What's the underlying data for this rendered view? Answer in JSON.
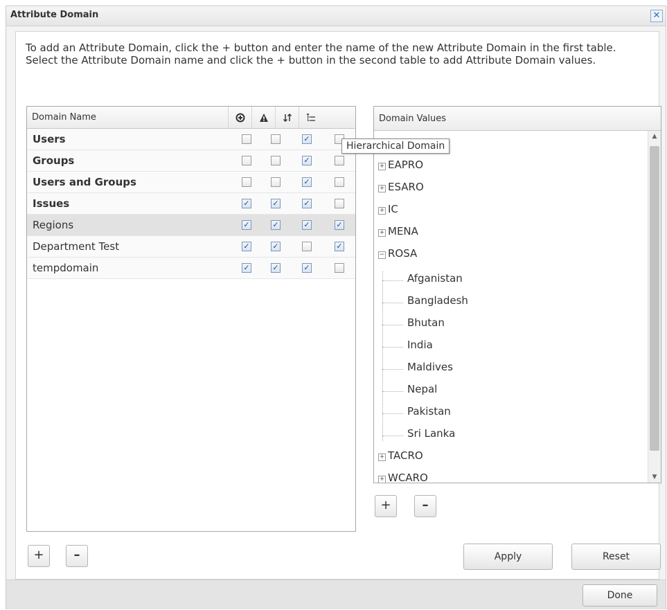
{
  "dialog": {
    "title": "Attribute Domain",
    "close_label": "✕",
    "instructions": "To add an Attribute Domain, click the + button and enter the name of the new Attribute Domain in the first table. Select the Attribute Domain name and click the + button in the second table to add Attribute Domain values."
  },
  "domains_table": {
    "header": "Domain Name",
    "column_icons": [
      "add-circle-icon",
      "warning-icon",
      "sort-icon",
      "hierarchy-icon"
    ],
    "rows": [
      {
        "name": "Users",
        "bold": true,
        "checks": [
          false,
          false,
          true,
          false
        ]
      },
      {
        "name": "Groups",
        "bold": true,
        "checks": [
          false,
          false,
          true,
          false
        ]
      },
      {
        "name": "Users and Groups",
        "bold": true,
        "checks": [
          false,
          false,
          true,
          false
        ]
      },
      {
        "name": "Issues",
        "bold": true,
        "checks": [
          true,
          true,
          true,
          false
        ]
      },
      {
        "name": "Regions",
        "bold": false,
        "selected": true,
        "checks": [
          true,
          true,
          true,
          true
        ]
      },
      {
        "name": "Department Test",
        "bold": false,
        "checks": [
          true,
          true,
          false,
          true
        ]
      },
      {
        "name": "tempdomain",
        "bold": false,
        "checks": [
          true,
          true,
          true,
          false
        ]
      }
    ],
    "add_label": "+",
    "remove_label": "–"
  },
  "tooltip": "Hierarchical Domain",
  "values_panel": {
    "header": "Domain Values",
    "nodes": [
      {
        "label": "EAPRO",
        "expanded": false
      },
      {
        "label": "ESARO",
        "expanded": false
      },
      {
        "label": "IC",
        "expanded": false
      },
      {
        "label": "MENA",
        "expanded": false
      },
      {
        "label": "ROSA",
        "expanded": true,
        "children": [
          "Afganistan",
          "Bangladesh",
          "Bhutan",
          "India",
          "Maldives",
          "Nepal",
          "Pakistan",
          "Sri Lanka"
        ]
      },
      {
        "label": "TACRO",
        "expanded": false
      },
      {
        "label": "WCARO",
        "expanded": false
      }
    ],
    "add_label": "+",
    "remove_label": "–"
  },
  "buttons": {
    "apply": "Apply",
    "reset": "Reset",
    "done": "Done"
  }
}
